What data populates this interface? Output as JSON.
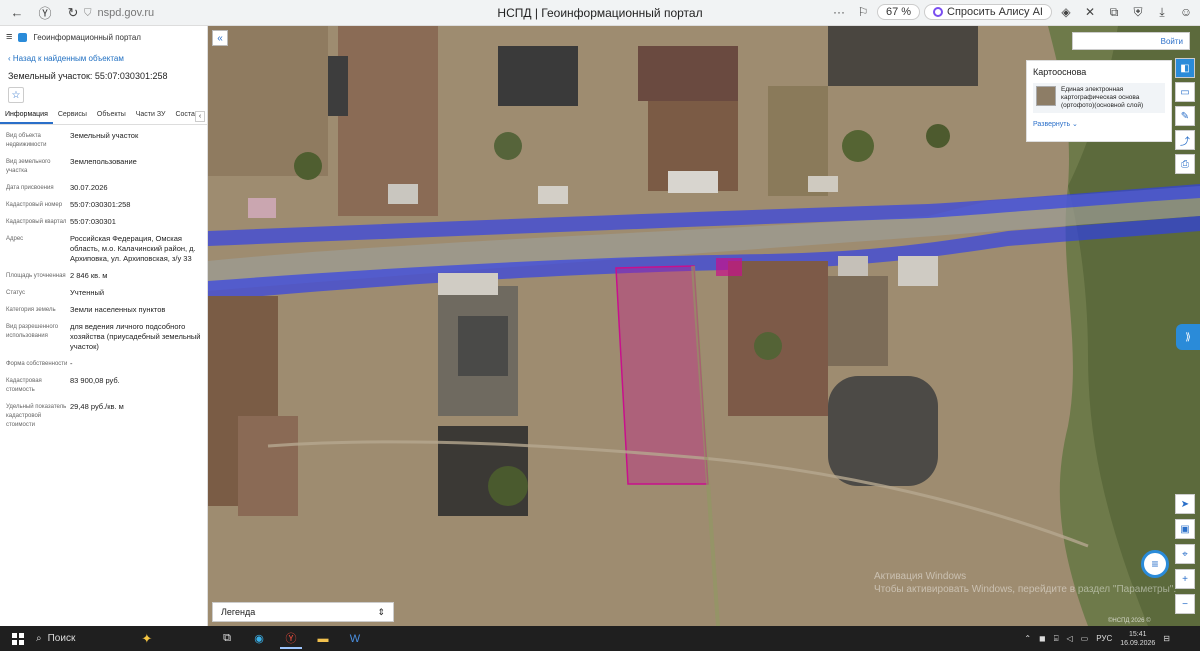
{
  "browser": {
    "url": "nspd.gov.ru",
    "title": "НСПД | Геоинформационный портал",
    "zoom": "67 %",
    "alice": "Спросить Алису AI"
  },
  "sidebar": {
    "app_name": "Геоинформационный портал",
    "back_link": "Назад к найденным объектам",
    "object_title": "Земельный участок: 55:07:030301:258",
    "tabs": [
      "Информация",
      "Сервисы",
      "Объекты",
      "Части ЗУ",
      "Состав"
    ],
    "rows": [
      {
        "k": "Вид объекта недвижимости",
        "v": "Земельный участок"
      },
      {
        "k": "Вид земельного участка",
        "v": "Землепользование"
      },
      {
        "k": "Дата присвоения",
        "v": "30.07.2026"
      },
      {
        "k": "Кадастровый номер",
        "v": "55:07:030301:258"
      },
      {
        "k": "Кадастровый квартал",
        "v": "55:07:030301"
      },
      {
        "k": "Адрес",
        "v": "Российская Федерация, Омская область, м.о. Калачинский район, д. Архиповка, ул. Архиповская, з/у 33"
      },
      {
        "k": "Площадь уточненная",
        "v": "2 846 кв. м"
      },
      {
        "k": "Статус",
        "v": "Учтенный"
      },
      {
        "k": "Категория земель",
        "v": "Земли населенных пунктов"
      },
      {
        "k": "Вид разрешенного использования",
        "v": "для ведения личного подсобного хозяйства (приусадебный земельный участок)"
      },
      {
        "k": "Форма собственности",
        "v": "-"
      },
      {
        "k": "Кадастровая стоимость",
        "v": "83 900,08 руб."
      },
      {
        "k": "Удельный показатель кадастровой стоимости",
        "v": "29,48 руб./кв. м"
      }
    ]
  },
  "map": {
    "login": "Войти",
    "layer_panel_title": "Картооснова",
    "layer_name": "Единая электронная картографическая основа (ортофото)(основной слой)",
    "expand": "Развернуть",
    "legend": "Легенда",
    "watermark_line1": "Активация Windows",
    "watermark_line2": "Чтобы активировать Windows, перейдите в раздел \"Параметры\".",
    "attribution": "©НСПД 2026 ©"
  },
  "taskbar": {
    "search": "Поиск",
    "lang": "РУС",
    "time": "15:41",
    "date": "16.09.2026"
  },
  "colors": {
    "accent": "#2a8bd9",
    "parcel": "#c8108c",
    "road_overlay": "#2b3cf0"
  }
}
